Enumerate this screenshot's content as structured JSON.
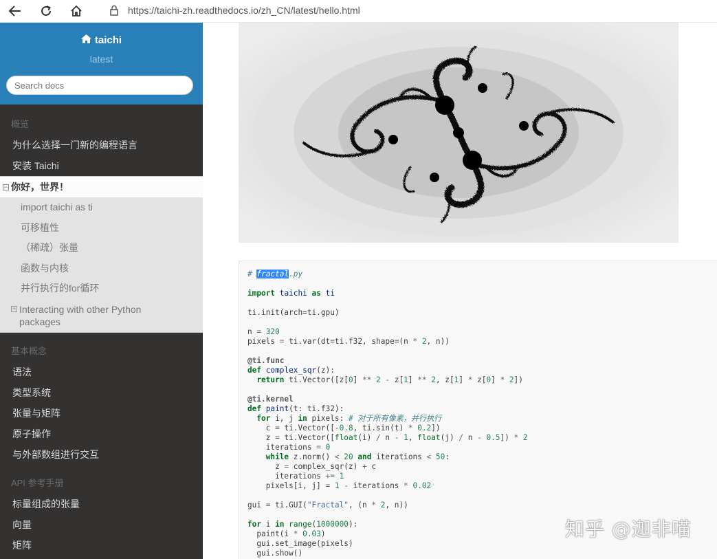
{
  "browser": {
    "url": "https://taichi-zh.readthedocs.io/zh_CN/latest/hello.html"
  },
  "sidebar": {
    "brand": "taichi",
    "version": "latest",
    "search_placeholder": "Search docs",
    "sections": [
      {
        "caption": "概览",
        "items": [
          "为什么选择一门新的编程语言",
          "安装 Taichi"
        ]
      },
      {
        "caption": "基本概念",
        "items": [
          "语法",
          "类型系统",
          "张量与矩阵",
          "原子操作",
          "与外部数组进行交互"
        ]
      },
      {
        "caption": "API 参考手册",
        "items": [
          "标量组成的张量",
          "向量",
          "矩阵"
        ]
      }
    ],
    "current": {
      "label": "你好，世界！",
      "toggle": "⊟",
      "children": [
        "import taichi as ti",
        "可移植性",
        "（稀疏）张量",
        "函数与内核",
        "并行执行的for循环"
      ],
      "expandable_child": {
        "toggle": "⊞",
        "line1": "Interacting with other Python",
        "line2": "packages"
      }
    }
  },
  "code": {
    "filename_hash": "# ",
    "filename_selected": "fractal",
    "filename_ext": ".py",
    "comment_parallel": "# 对于所有像素，并行执行",
    "gui_title": "\"Fractal\""
  },
  "watermark": "知乎 @迦非喵",
  "colors": {
    "sidebar_header": "#2980b9",
    "sidebar_bg": "#343131",
    "selection": "#3388ff"
  }
}
